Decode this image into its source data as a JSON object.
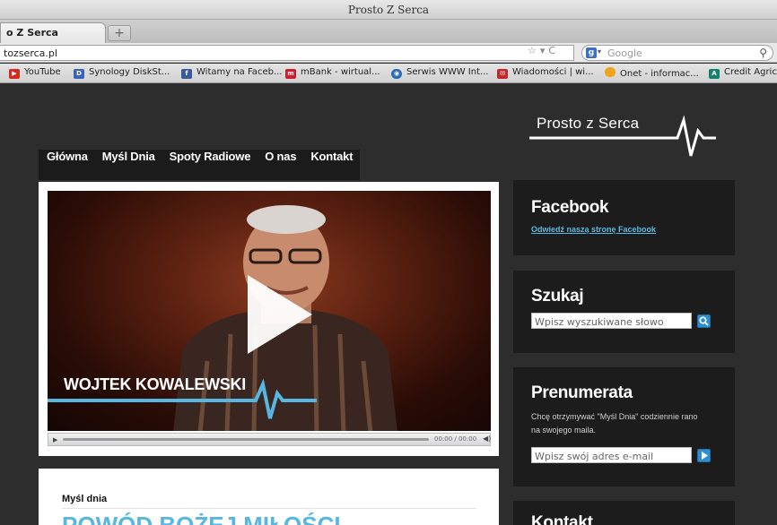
{
  "browser": {
    "window_title": "Prosto Z Serca",
    "tab_label": "o Z Serca",
    "new_tab_label": "+",
    "url": "tozserca.pl",
    "search_engine": "Google",
    "search_placeholder": "Google",
    "bookmarks": [
      {
        "label": "YouTube",
        "icon": "youtube-icon",
        "color": "#d32a1f"
      },
      {
        "label": "Synology DiskSt...",
        "icon": "synology-icon",
        "color": "#3a63b8"
      },
      {
        "label": "Witamy na Faceb...",
        "icon": "facebook-icon",
        "color": "#3b5998"
      },
      {
        "label": "mBank - wirtual...",
        "icon": "mbank-icon",
        "color": "#c8202e"
      },
      {
        "label": "Serwis WWW Int...",
        "icon": "globe-icon",
        "color": "#2c6bb0"
      },
      {
        "label": "Wiadomości | wi...",
        "icon": "mail-icon",
        "color": "#c0282d"
      },
      {
        "label": "Onet - informac...",
        "icon": "onet-icon",
        "color": "#f0a31c"
      },
      {
        "label": "Credit Agric",
        "icon": "credit-agricole-icon",
        "color": "#17806d"
      }
    ]
  },
  "site": {
    "logo_text": "Prosto z Serca",
    "nav": [
      "Główna",
      "Myśl Dnia",
      "Spoty Radiowe",
      "O nas",
      "Kontakt"
    ],
    "video": {
      "lower_third_name": "WOJTEK KOWALEWSKI",
      "time_display": "00:00 / 00:00"
    },
    "post": {
      "kicker": "Myśl dnia",
      "headline": "POWÓD BOŻEJ MIŁOŚCI"
    },
    "sidebar": {
      "facebook": {
        "title": "Facebook",
        "link": "Odwiedź naszą stronę Facebook"
      },
      "search": {
        "title": "Szukaj",
        "placeholder": "Wpisz wyszukiwane słowo"
      },
      "subscribe": {
        "title": "Prenumerata",
        "description": "Chcę otrzymywać \"Myśl Dnia\" codziennie rano na swojego maila.",
        "placeholder": "Wpisz swój adres e-mail"
      },
      "contact": {
        "title": "Kontakt"
      }
    },
    "colors": {
      "accent": "#58b7e0",
      "background": "#2d2d2d",
      "panel": "#1c1c1c"
    }
  }
}
